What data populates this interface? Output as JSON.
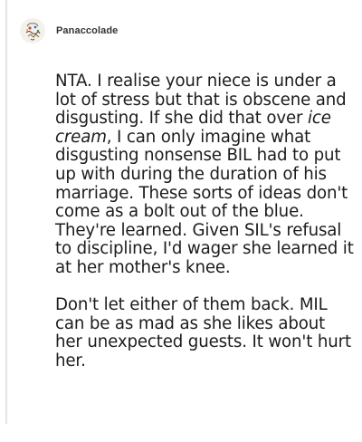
{
  "comment": {
    "author": "Panaccolade",
    "avatar_icon": "avatar-icon",
    "paragraphs": [
      {
        "before": "NTA. I realise your niece is under a lot of stress but that is obscene and disgusting. If she did that over ",
        "emphasis": "ice cream",
        "after": ", I can only imagine what disgusting nonsense BIL had to put up with during the duration of his marriage. These sorts of ideas don't come as a bolt out of the blue. They're learned. Given SIL's refusal to discipline, I'd wager she learned it at her mother's knee."
      },
      {
        "text": "Don't let either of them back. MIL can be as mad as she likes about her unexpected guests. It won't hurt her."
      }
    ]
  },
  "colors": {
    "text": "#1c1c1c",
    "username": "#333333",
    "thread_line": "#e4e4e4",
    "background": "#ffffff"
  }
}
